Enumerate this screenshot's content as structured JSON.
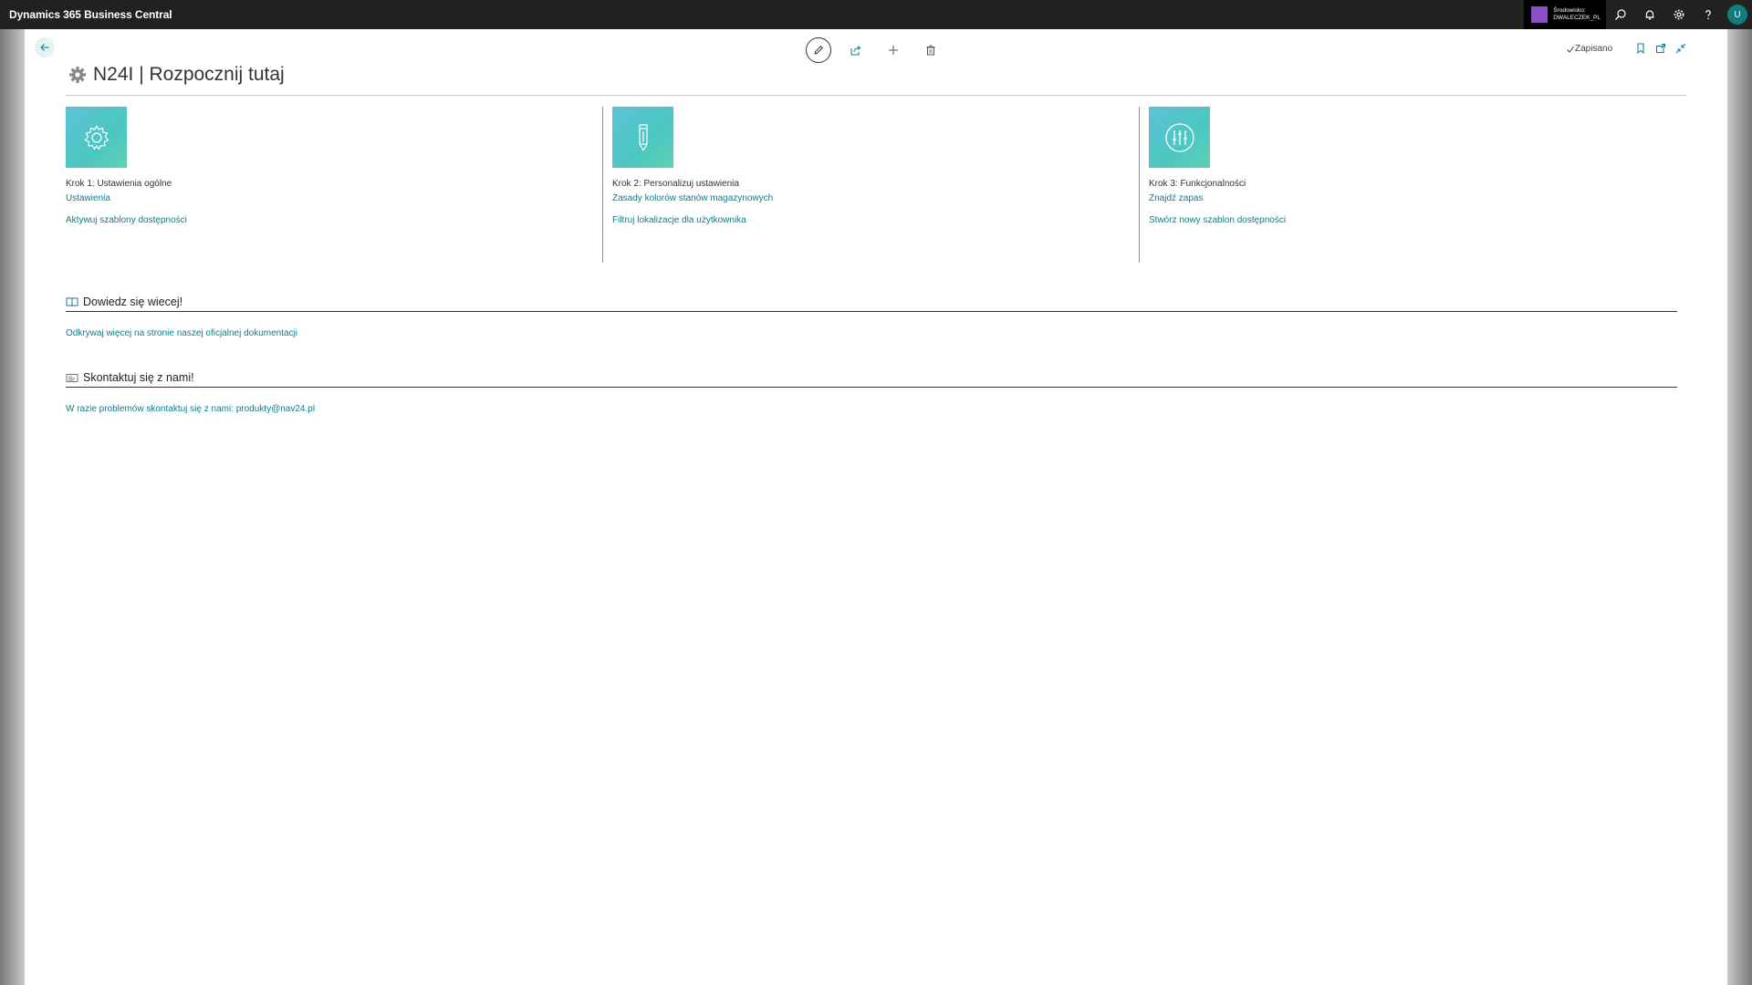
{
  "app": {
    "title": "Dynamics 365 Business Central",
    "environment_label": "Środowisko:",
    "environment_name": "DWALECZEK_PL",
    "user_initial": "U"
  },
  "colors": {
    "appbar": "#212121",
    "accent": "#0a7e8c",
    "tile_gradient_start": "#5cc3d6",
    "tile_gradient_end": "#5fd2b3",
    "environment_swatch": "#8a4fc6",
    "avatar": "#0e7d7b"
  },
  "header_icons": [
    "search-icon",
    "bell-icon",
    "gear-icon",
    "help-icon"
  ],
  "toolbar": {
    "icons": [
      "edit-icon",
      "share-icon",
      "plus-icon",
      "trash-icon"
    ],
    "saved_label": "Zapisano",
    "right_icons": [
      "bookmark-icon",
      "open-new-window-icon",
      "collapse-icon"
    ]
  },
  "page": {
    "title": "N24I | Rozpocznij tutaj"
  },
  "steps": [
    {
      "title": "Krok 1: Ustawienia ogólne",
      "icon": "gear-icon",
      "links": [
        "Ustawienia",
        "Aktywuj szablony dostępności"
      ]
    },
    {
      "title": "Krok 2: Personalizuj ustawienia",
      "icon": "pencil-icon",
      "links": [
        "Zasady kolorów stanów magazynowych",
        "Filtruj lokalizacje dla użytkownika"
      ]
    },
    {
      "title": "Krok 3: Funkcjonalności",
      "icon": "sliders-icon",
      "links": [
        "Znajdź zapas",
        "Stwórz nowy szablon dostępności"
      ]
    }
  ],
  "learn_more": {
    "heading": "Dowiedz się wiecej!",
    "icon": "book-icon",
    "link": "Odkrywaj więcej na stronie naszej oficjalnej dokumentacji"
  },
  "contact": {
    "heading": "Skontaktuj się z nami!",
    "icon": "contact-card-icon",
    "text": "W razie problemów skontaktuj się z nami: produkty@nav24.pl"
  }
}
